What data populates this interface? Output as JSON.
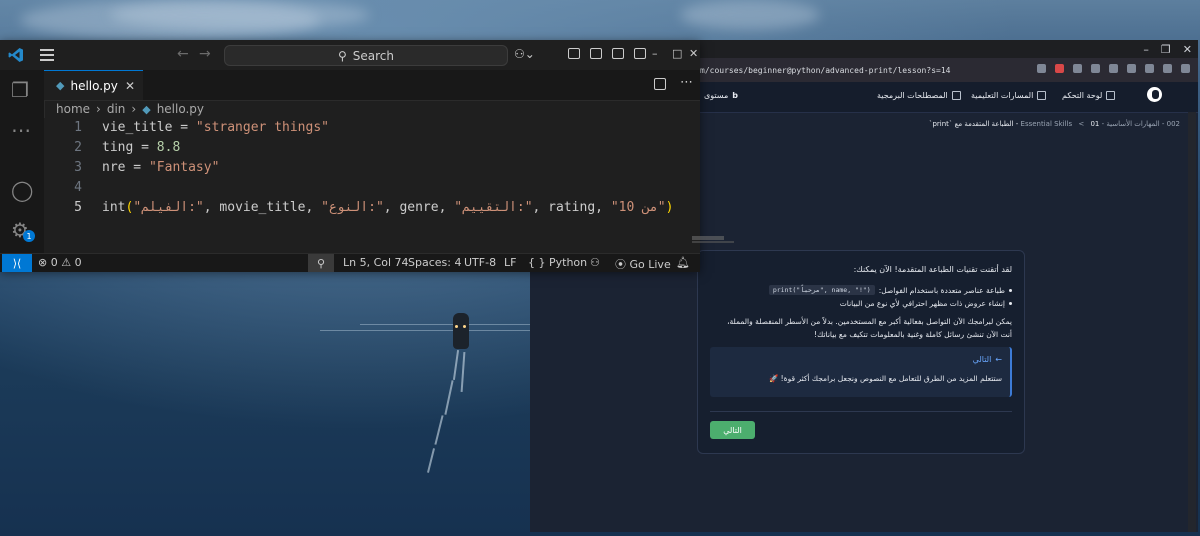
{
  "vscode": {
    "search_label": "Search",
    "tab": {
      "filename": "hello.py"
    },
    "breadcrumb": [
      "home",
      "din",
      "hello.py"
    ],
    "lines": [
      {
        "n": "1",
        "parts": [
          {
            "t": "vie_title = ",
            "c": "plain"
          },
          {
            "t": "\"stranger things\"",
            "c": "str"
          }
        ]
      },
      {
        "n": "2",
        "parts": [
          {
            "t": "ting = ",
            "c": "plain"
          },
          {
            "t": "8.8",
            "c": "num"
          }
        ]
      },
      {
        "n": "3",
        "parts": [
          {
            "t": "nre = ",
            "c": "plain"
          },
          {
            "t": "\"Fantasy\"",
            "c": "str"
          }
        ]
      },
      {
        "n": "4",
        "parts": []
      },
      {
        "n": "5",
        "parts": [
          {
            "t": "int",
            "c": "plain"
          },
          {
            "t": "(",
            "c": "paren"
          },
          {
            "t": "\"الفيلم:\"",
            "c": "str"
          },
          {
            "t": ", movie_title, ",
            "c": "plain"
          },
          {
            "t": "\"النوع:\"",
            "c": "str"
          },
          {
            "t": ", genre, ",
            "c": "plain"
          },
          {
            "t": "\"التقييم:\"",
            "c": "str"
          },
          {
            "t": ", rating, ",
            "c": "plain"
          },
          {
            "t": "\"10 من\"",
            "c": "str"
          },
          {
            "t": ")",
            "c": "paren"
          }
        ]
      }
    ],
    "status": {
      "errors": "0",
      "warnings": "0",
      "cursor": "Ln 5, Col 74",
      "spaces": "Spaces: 4",
      "encoding": "UTF-8",
      "eol": "LF",
      "language": "Python",
      "golive": "Go Live"
    },
    "accounts_badge": "1"
  },
  "browser": {
    "url": "m/courses/beginner@python/advanced-print/lesson?s=14",
    "nav": {
      "logo_label": "لوحة التحكم",
      "paths": "المسارات التعليمية",
      "glossary": "المصطلحات البرمجية",
      "level": "مستوى"
    },
    "breadcrumb": {
      "part1": "002 - المهارات الأساسية - Essential Skills",
      "sep": "<",
      "part2": "01 - الطباعة المتقدمة مع `print`"
    },
    "card": {
      "intro": "لقد أتقنت تقنيات الطباعة المتقدمة! الآن يمكنك:",
      "bullet1_text": "طباعة عناصر متعددة باستخدام الفواصل:",
      "bullet1_code": "print(\"مرحباً\", name, \"!\")",
      "bullet2_text": "إنشاء عروض ذات مظهر احترافي لأي نوع من البيانات",
      "para": "يمكن لبرامجك الآن التواصل بفعالية أكبر مع المستخدمين. بدلاً من الأسطر المنفصلة والمملة، أنت الآن تنشئ رسائل كاملة وغنية بالمعلومات تتكيف مع بياناتك!",
      "next_title": "التالي",
      "next_text": "ستتعلم المزيد من الطرق للتعامل مع النصوص ونجعل برامجك أكثر قوة! 🚀",
      "next_button": "التالي"
    }
  }
}
